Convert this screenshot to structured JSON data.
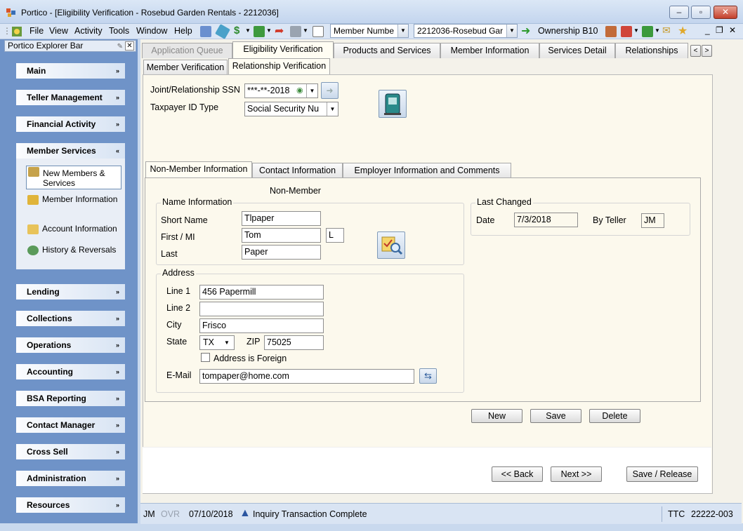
{
  "window": {
    "title": "Portico - [Eligibility Verification - Rosebud Garden Rentals - 2212036]",
    "minimize": "–",
    "restore": "▫",
    "close": "✕",
    "mdi_min": "_",
    "mdi_restore": "❐",
    "mdi_close": "✕"
  },
  "menu": [
    "File",
    "View",
    "Activity",
    "Tools",
    "Window",
    "Help"
  ],
  "toolbar": {
    "search_type": "Member Numbe",
    "member_selector": "2212036-Rosebud Gar",
    "ownership": "Ownership B10",
    "icons": [
      "portico-icon",
      "calculator-icon",
      "tag-icon",
      "dollar-icon",
      "cash-icon",
      "arrow-icon",
      "printer-icon",
      "page-icon"
    ]
  },
  "explorer": {
    "title": "Portico Explorer Bar",
    "sections_top": [
      {
        "label": "Main",
        "chev": "»"
      },
      {
        "label": "Teller Management",
        "chev": "»"
      },
      {
        "label": "Financial Activity",
        "chev": "»"
      }
    ],
    "member_services": {
      "label": "Member Services",
      "chev": "«",
      "items": [
        {
          "label": "New Members & Services",
          "icon": "new-members-icon",
          "selected": true
        },
        {
          "label": "Member Information",
          "icon": "member-info-icon"
        },
        {
          "label": "Account Information",
          "icon": "account-info-icon"
        },
        {
          "label": "History & Reversals",
          "icon": "history-icon"
        }
      ]
    },
    "sections_bottom": [
      {
        "label": "Lending",
        "chev": "»"
      },
      {
        "label": "Collections",
        "chev": "»"
      },
      {
        "label": "Operations",
        "chev": "»"
      },
      {
        "label": "Accounting",
        "chev": "»"
      },
      {
        "label": "BSA Reporting",
        "chev": "»"
      },
      {
        "label": "Contact Manager",
        "chev": "»"
      },
      {
        "label": "Cross Sell",
        "chev": "»"
      },
      {
        "label": "Administration",
        "chev": "»"
      },
      {
        "label": "Resources",
        "chev": "»"
      }
    ]
  },
  "tabs": {
    "main": [
      "Application Queue",
      "Eligibility Verification",
      "Products and Services",
      "Member Information",
      "Services Detail",
      "Relationships"
    ],
    "sub": [
      "Member Verification",
      "Relationship Verification"
    ],
    "info": [
      "Non-Member Information",
      "Contact Information",
      "Employer Information and Comments"
    ],
    "scroll_left": "<",
    "scroll_right": ">"
  },
  "relationship": {
    "ssn_label": "Joint/Relationship SSN",
    "ssn_value": "***-**-2018",
    "taxid_label": "Taxpayer ID Type",
    "taxid_value": "Social Security Nu"
  },
  "nonmember": {
    "heading": "Non-Member",
    "name_group": "Name Information",
    "short_name_label": "Short Name",
    "short_name": "Tlpaper",
    "first_mi_label": "First / MI",
    "first": "Tom",
    "mi": "L",
    "last_label": "Last",
    "last": "Paper",
    "last_changed_group": "Last Changed",
    "date_label": "Date",
    "date": "7/3/2018",
    "by_teller_label": "By Teller",
    "by_teller": "JM",
    "address_group": "Address",
    "line1_label": "Line 1",
    "line1": "456 Papermill",
    "line2_label": "Line 2",
    "line2": "",
    "city_label": "City",
    "city": "Frisco",
    "state_label": "State",
    "state": "TX",
    "zip_label": "ZIP",
    "zip": "75025",
    "foreign_label": "Address is Foreign",
    "foreign_checked": false,
    "email_label": "E-Mail",
    "email": "tompaper@home.com"
  },
  "buttons": {
    "new": "New",
    "save": "Save",
    "delete": "Delete",
    "back": "<< Back",
    "next": "Next >>",
    "save_release": "Save / Release"
  },
  "status": {
    "teller": "JM",
    "ovr": "OVR",
    "date": "07/10/2018",
    "message": "Inquiry Transaction Complete",
    "ttc": "TTC",
    "code": "22222-003"
  },
  "colors": {
    "explorer_bg": "#6f93c8",
    "pane_bg": "#fcf9ed"
  }
}
